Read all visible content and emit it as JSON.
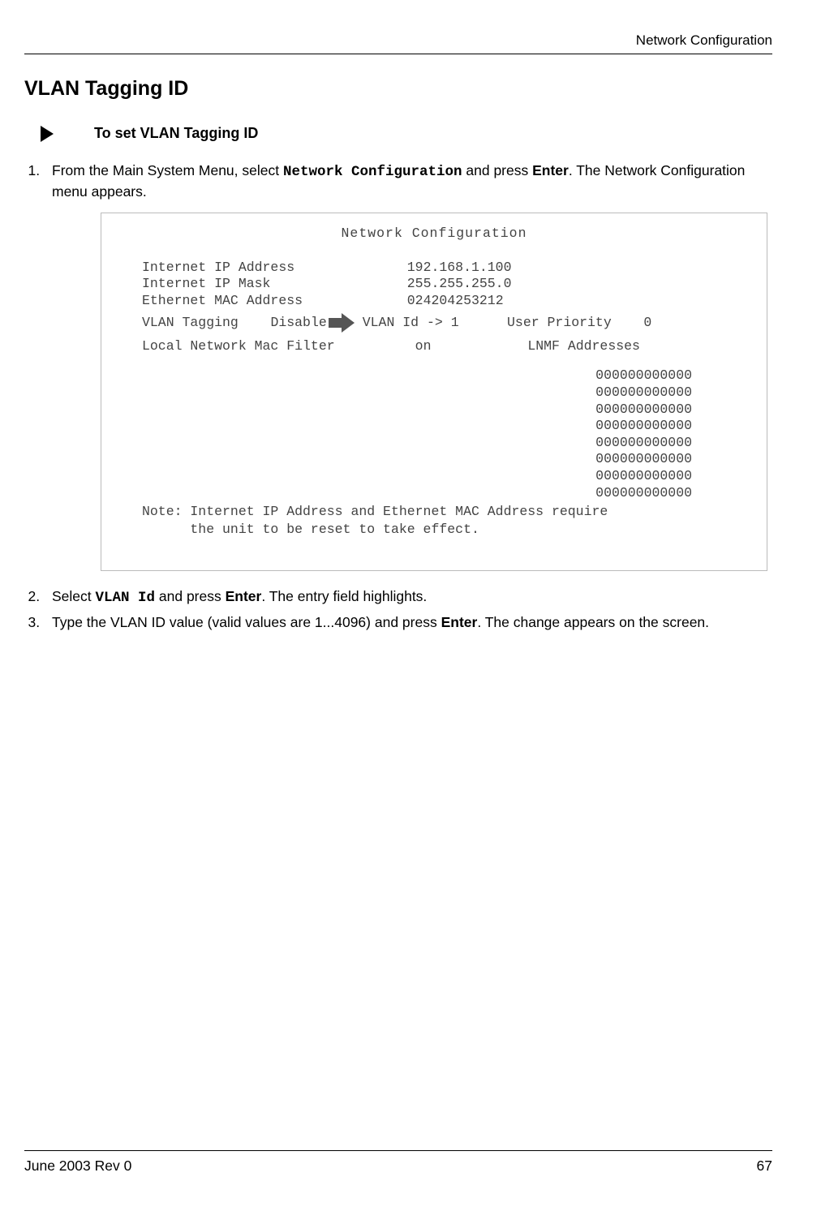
{
  "header": {
    "chapter": "Network Configuration"
  },
  "section": {
    "title": "VLAN Tagging ID",
    "procedure_title": "To set VLAN Tagging ID"
  },
  "steps": {
    "s1_a": "From the Main System Menu, select ",
    "s1_code": "Network Configuration",
    "s1_b": " and press ",
    "s1_bold": "Enter",
    "s1_c": ". The Network Configuration menu appears.",
    "s2_a": "Select ",
    "s2_code": "VLAN Id",
    "s2_b": " and press ",
    "s2_bold": "Enter",
    "s2_c": ". The entry field highlights.",
    "s3_a": "Type the VLAN ID value (valid values are 1...4096) and press ",
    "s3_bold": "Enter",
    "s3_b": ". The change appears on the screen."
  },
  "screen": {
    "title": "Network Configuration",
    "ip_label": "Internet IP Address",
    "ip_value": "192.168.1.100",
    "mask_label": "Internet IP Mask",
    "mask_value": "255.255.255.0",
    "mac_label": "Ethernet MAC Address",
    "mac_value": "024204253212",
    "vlan_tag_label": "VLAN Tagging",
    "vlan_tag_value": "Disable",
    "vlan_id_label": "VLAN Id ->",
    "vlan_id_value": "1",
    "user_priority_label": "User Priority",
    "user_priority_value": "0",
    "lnmf_label": "Local Network Mac Filter",
    "lnmf_status": "on",
    "lnmf_addr_label": "LNMF Addresses",
    "lnmf_addresses": [
      "000000000000",
      "000000000000",
      "000000000000",
      "000000000000",
      "000000000000",
      "000000000000",
      "000000000000",
      "000000000000"
    ],
    "note_line1": "Note: Internet IP Address and Ethernet MAC Address require",
    "note_line2": "      the unit to be reset to take effect."
  },
  "footer": {
    "left": "June 2003 Rev 0",
    "right": "67"
  }
}
